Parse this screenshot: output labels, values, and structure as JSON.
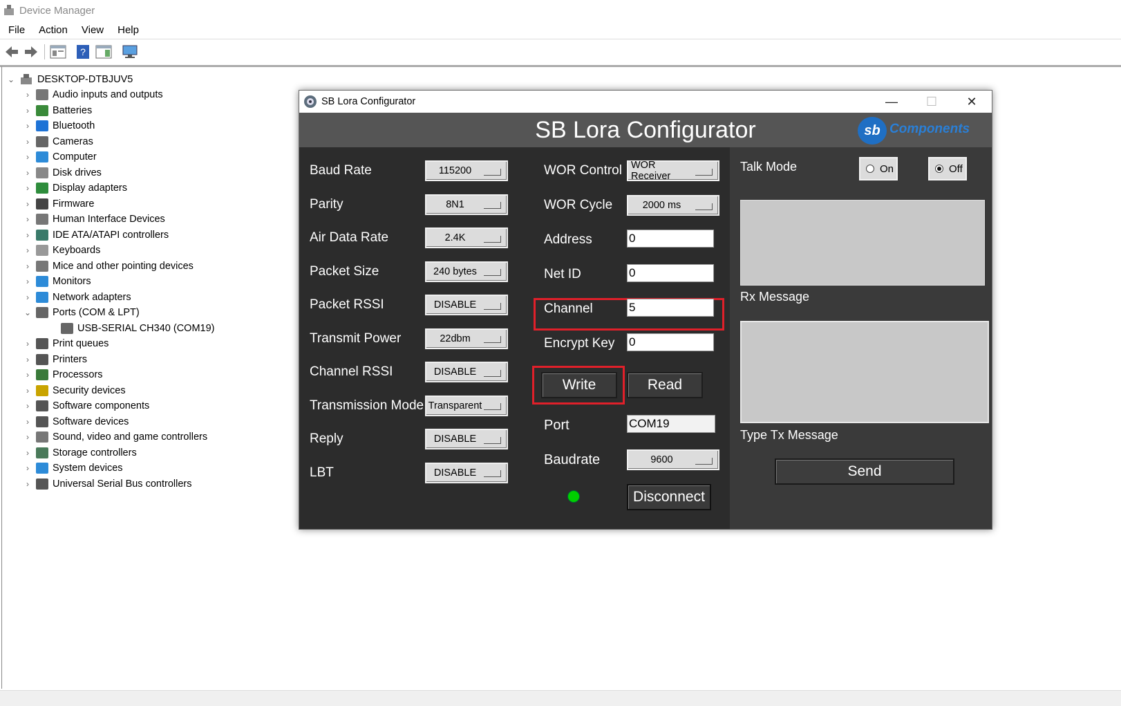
{
  "device_manager": {
    "title": "Device Manager",
    "menu": [
      "File",
      "Action",
      "View",
      "Help"
    ],
    "tree": {
      "root": "DESKTOP-DTBJUV5",
      "items": [
        {
          "label": "Audio inputs and outputs",
          "icon": "speaker-icon",
          "color": "#777"
        },
        {
          "label": "Batteries",
          "icon": "battery-icon",
          "color": "#3a8a3a"
        },
        {
          "label": "Bluetooth",
          "icon": "bluetooth-icon",
          "color": "#1e73d6"
        },
        {
          "label": "Cameras",
          "icon": "camera-icon",
          "color": "#666"
        },
        {
          "label": "Computer",
          "icon": "computer-icon",
          "color": "#2d8bd8"
        },
        {
          "label": "Disk drives",
          "icon": "disk-icon",
          "color": "#888"
        },
        {
          "label": "Display adapters",
          "icon": "display-adapter-icon",
          "color": "#2e8d3c"
        },
        {
          "label": "Firmware",
          "icon": "firmware-icon",
          "color": "#444"
        },
        {
          "label": "Human Interface Devices",
          "icon": "hid-icon",
          "color": "#777"
        },
        {
          "label": "IDE ATA/ATAPI controllers",
          "icon": "ide-icon",
          "color": "#3a7a6a"
        },
        {
          "label": "Keyboards",
          "icon": "keyboard-icon",
          "color": "#999"
        },
        {
          "label": "Mice and other pointing devices",
          "icon": "mouse-icon",
          "color": "#777"
        },
        {
          "label": "Monitors",
          "icon": "monitor-icon",
          "color": "#2d8bd8"
        },
        {
          "label": "Network adapters",
          "icon": "network-icon",
          "color": "#2d8bd8"
        },
        {
          "label": "Ports (COM & LPT)",
          "icon": "port-icon",
          "color": "#666",
          "expanded": true
        },
        {
          "label": "USB-SERIAL CH340 (COM19)",
          "icon": "port-device-icon",
          "color": "#666",
          "child": true
        },
        {
          "label": "Print queues",
          "icon": "print-queue-icon",
          "color": "#555"
        },
        {
          "label": "Printers",
          "icon": "printer-icon",
          "color": "#555"
        },
        {
          "label": "Processors",
          "icon": "processor-icon",
          "color": "#3a7a3a"
        },
        {
          "label": "Security devices",
          "icon": "security-icon",
          "color": "#c9a400"
        },
        {
          "label": "Software components",
          "icon": "software-component-icon",
          "color": "#555"
        },
        {
          "label": "Software devices",
          "icon": "software-device-icon",
          "color": "#555"
        },
        {
          "label": "Sound, video and game controllers",
          "icon": "sound-icon",
          "color": "#777"
        },
        {
          "label": "Storage controllers",
          "icon": "storage-icon",
          "color": "#4a7a5a"
        },
        {
          "label": "System devices",
          "icon": "system-icon",
          "color": "#2d8bd8"
        },
        {
          "label": "Universal Serial Bus controllers",
          "icon": "usb-icon",
          "color": "#555"
        }
      ]
    }
  },
  "configurator": {
    "window_title": "SB Lora Configurator",
    "header_title": "SB Lora Configurator",
    "logo_text": "Components",
    "logo_mark": "sb",
    "left_fields": [
      {
        "label": "Baud Rate",
        "value": "115200"
      },
      {
        "label": "Parity",
        "value": "8N1"
      },
      {
        "label": "Air Data Rate",
        "value": "2.4K"
      },
      {
        "label": "Packet Size",
        "value": "240 bytes"
      },
      {
        "label": "Packet RSSI",
        "value": "DISABLE"
      },
      {
        "label": "Transmit Power",
        "value": "22dbm"
      },
      {
        "label": "Channel RSSI",
        "value": "DISABLE"
      },
      {
        "label": "Transmission Mode",
        "value": "Transparent"
      },
      {
        "label": "Reply",
        "value": "DISABLE"
      },
      {
        "label": "LBT",
        "value": "DISABLE"
      }
    ],
    "wor_control": {
      "label": "WOR Control",
      "value": "WOR Receiver"
    },
    "wor_cycle": {
      "label": "WOR Cycle",
      "value": "2000 ms"
    },
    "address": {
      "label": "Address",
      "value": "0"
    },
    "net_id": {
      "label": "Net ID",
      "value": "0"
    },
    "channel": {
      "label": "Channel",
      "value": "5"
    },
    "encrypt_key": {
      "label": "Encrypt Key",
      "value": "0"
    },
    "write_label": "Write",
    "read_label": "Read",
    "port": {
      "label": "Port",
      "value": "COM19"
    },
    "baudrate": {
      "label": "Baudrate",
      "value": "9600"
    },
    "disconnect_label": "Disconnect",
    "talk_mode": {
      "label": "Talk Mode",
      "on": "On",
      "off": "Off",
      "selected": "Off"
    },
    "rx_label": "Rx Message",
    "tx_label": "Type Tx Message",
    "send_label": "Send",
    "colors": {
      "highlight": "#e0202a",
      "led": "#00d000"
    }
  }
}
